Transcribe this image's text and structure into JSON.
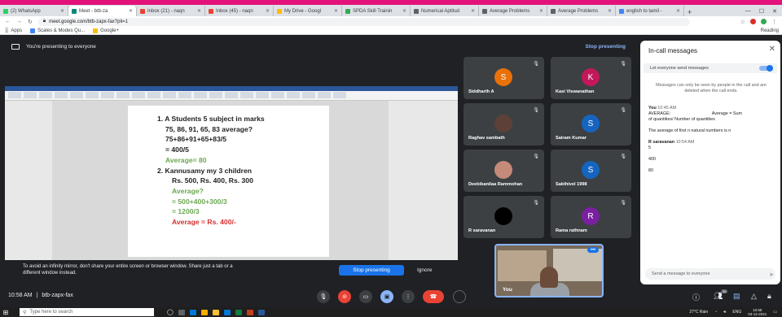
{
  "browser": {
    "tabs": [
      {
        "title": "(2) WhatsApp",
        "color": "#25d366"
      },
      {
        "title": "Meet - btb-za",
        "color": "#00897b",
        "active": true
      },
      {
        "title": "Inbox (21) - naqn",
        "color": "#ea4335"
      },
      {
        "title": "Inbox (45) - naqn",
        "color": "#ea4335"
      },
      {
        "title": "My Drive - Googl",
        "color": "#fbbc04"
      },
      {
        "title": "SPDA Skill Trainin",
        "color": "#34a853"
      },
      {
        "title": "Numerical Aptitud",
        "color": "#5f6368"
      },
      {
        "title": "Average Problems",
        "color": "#5f6368"
      },
      {
        "title": "Average Problems",
        "color": "#5f6368"
      },
      {
        "title": "english to tamil -",
        "color": "#4285f4"
      }
    ],
    "new_tab": "+",
    "url": "meet.google.com/btb-zapx-fax?pli=1",
    "bookmarks": [
      "Apps",
      "Scales & Modes Qu...",
      "Google+"
    ],
    "reading_list": "Reading"
  },
  "meet": {
    "presenting_text": "You're presenting to everyone",
    "stop_presenting": "Stop presenting",
    "meeting_time": "10:58 AM",
    "meeting_code": "btb-zapx-fax",
    "warning_text": "To avoid an infinity mirror, don't share your entire screen or browser window. Share just a tab or a different window instead.",
    "warning_stop": "Stop presenting",
    "warning_ignore": "Ignore",
    "participants_badge": "30"
  },
  "document": {
    "lines": [
      {
        "text": "1.  A Students 5 subject in marks",
        "style": "q"
      },
      {
        "text": "75, 86, 91, 65, 83 average?",
        "style": "q",
        "indent": 10
      },
      {
        "text": "75+86+91+65+83/5",
        "style": "q",
        "indent": 10
      },
      {
        "text": "= 400/5",
        "style": "q",
        "indent": 10
      },
      {
        "text": "Average= 80",
        "style": "g",
        "indent": 10
      },
      {
        "text": "2.  Kannusamy my 3 children",
        "style": "q"
      },
      {
        "text": "Rs. 500, Rs. 400, Rs. 300",
        "style": "q",
        "indent": 18
      },
      {
        "text": "Average?",
        "style": "g",
        "indent": 18
      },
      {
        "text": "= 500+400+300/3",
        "style": "g",
        "indent": 18
      },
      {
        "text": "= 1200/3",
        "style": "g",
        "indent": 18
      },
      {
        "text": "Average = Rs. 400/-",
        "style": "r",
        "indent": 18
      }
    ]
  },
  "participants": [
    {
      "name": "Siddharth A",
      "initial": "S",
      "color": "#e8710a"
    },
    {
      "name": "Kasi Viswanathan",
      "initial": "K",
      "color": "#c2185b"
    },
    {
      "name": "Raghav sambath",
      "initial": "",
      "color": "#5d4037"
    },
    {
      "name": "Sairam Kumar",
      "initial": "S",
      "color": "#1565c0"
    },
    {
      "name": "Deebikanilaa Rammohan",
      "initial": "",
      "color": "#c48a7a"
    },
    {
      "name": "Sakthivel 1998",
      "initial": "S",
      "color": "#1565c0"
    },
    {
      "name": "R saravanan",
      "initial": "",
      "color": "#000000"
    },
    {
      "name": "Rama rathnam",
      "initial": "R",
      "color": "#7b1fa2"
    }
  ],
  "self": {
    "name": "You"
  },
  "chat": {
    "title": "In-call messages",
    "allow_label": "Let everyone send messages",
    "notice": "Messages can only be seen by people in the call and are deleted when the call ends.",
    "messages": [
      {
        "sender": "You",
        "time": "10:45 AM",
        "lines": [
          "AVERAGE:                                  Average = Sum",
          "of quantities/ Number of quantities",
          "",
          "The average of first n natural numbers is n"
        ]
      },
      {
        "sender": "R saravanan",
        "time": "10:54 AM",
        "lines": [
          "5",
          "",
          "400",
          "",
          "80"
        ]
      }
    ],
    "compose_placeholder": "Send a message to everyone"
  },
  "taskbar": {
    "search_placeholder": "Type here to search",
    "weather": "27°C Rain",
    "language": "ENG",
    "time": "10:58",
    "date": "03-12-2021"
  }
}
